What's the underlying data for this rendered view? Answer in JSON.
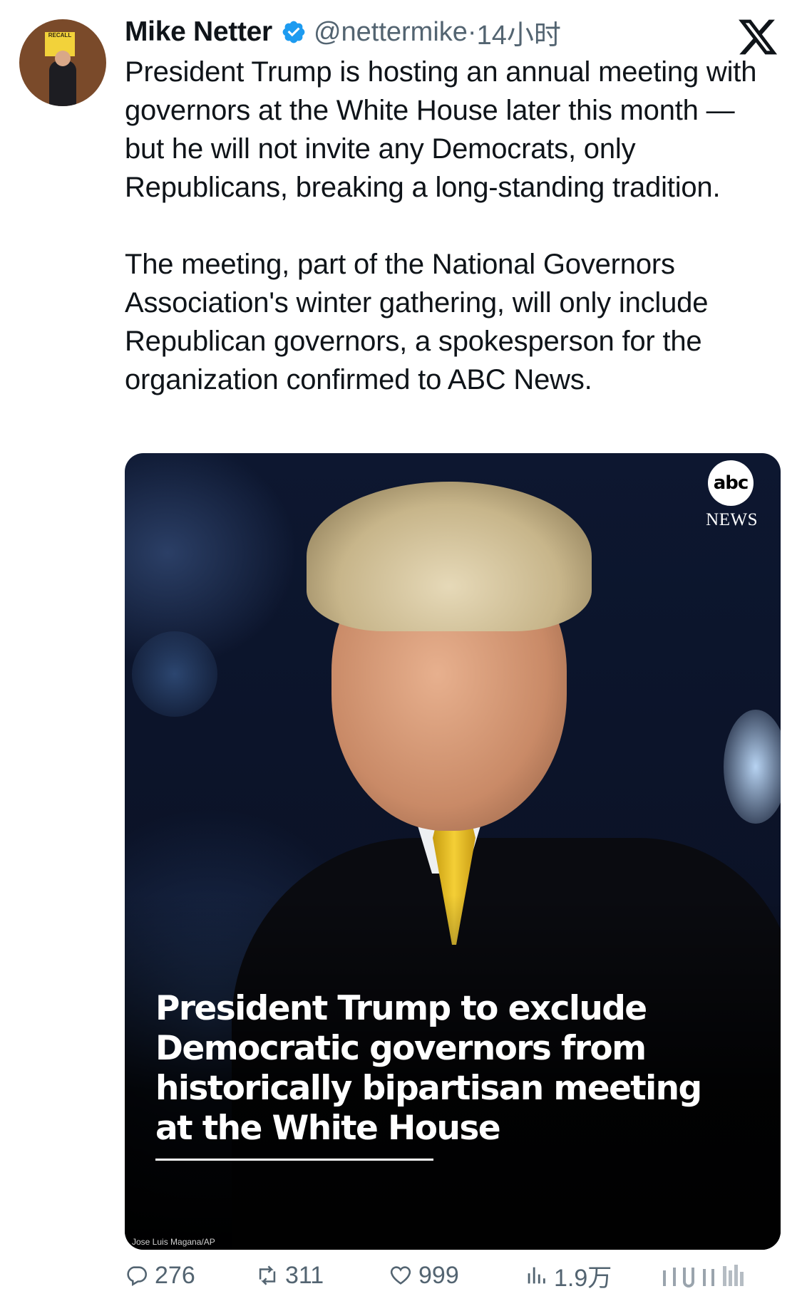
{
  "author": {
    "name": "Mike Netter",
    "handle": "@nettermike",
    "separator": "·",
    "time": "14小时"
  },
  "tweet": {
    "paragraph1": "President Trump is hosting an annual meeting with governors at the White House later this month — but he will not invite any Democrats, only Republicans, breaking a long-standing tradition.",
    "paragraph2": "The meeting, part of the National Governors Association's winter gathering, will only include Republican governors, a spokesperson for the organization confirmed to ABC News."
  },
  "media": {
    "logo_text": "abc",
    "logo_sub": "NEWS",
    "headline": "President Trump to exclude Democratic governors from historically bipartisan meeting at the White House",
    "photo_credit": "Jose Luis Magana/AP"
  },
  "avatar_sign": "RECALL",
  "stats": {
    "replies": "276",
    "retweets": "311",
    "likes": "999",
    "views": "1.9万"
  },
  "colors": {
    "text": "#0f1419",
    "secondary": "#536471",
    "verified": "#1d9bf0"
  },
  "icons": [
    "verified-badge-icon",
    "x-logo-icon",
    "reply-icon",
    "retweet-icon",
    "like-icon",
    "views-icon",
    "bookmark-share-icon"
  ]
}
